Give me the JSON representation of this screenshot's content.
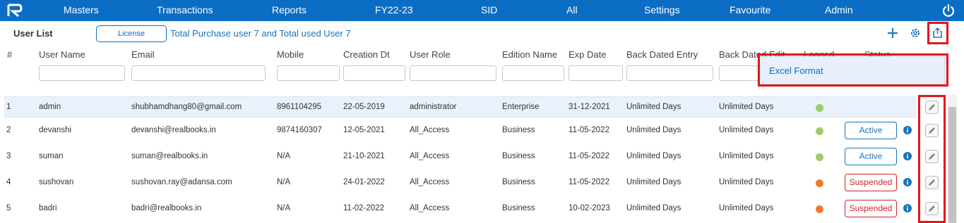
{
  "nav": {
    "items": [
      "Masters",
      "Transactions",
      "Reports",
      "FY22-23",
      "SID",
      "All",
      "Settings",
      "Favourite",
      "Admin"
    ],
    "logo_icon": "realbooks-logo-icon",
    "power_icon": "power-icon"
  },
  "toolbar": {
    "title": "User List",
    "license_label": "License",
    "license_info": "Total Purchase user 7 and Total used User 7",
    "add_icon": "plus-icon",
    "settings_icon": "gear-icon",
    "export_icon": "export-share-icon"
  },
  "export_menu": {
    "items": [
      "Excel Format"
    ]
  },
  "table": {
    "columns": [
      "#",
      "User Name",
      "Email",
      "Mobile",
      "Creation Dt",
      "User Role",
      "Edition Name",
      "Exp Date",
      "Back Dated Entry",
      "Back Dated Edit",
      "Logged",
      "Status"
    ],
    "rows": [
      {
        "num": "1",
        "user": "admin",
        "email": "shubhamdhang80@gmail.com",
        "mobile": "8961104295",
        "created": "22-05-2019",
        "role": "administrator",
        "edition": "Enterprise",
        "exp": "31-12-2021",
        "bde": "Unlimited Days",
        "bded": "Unlimited Days",
        "logged": "green",
        "status": ""
      },
      {
        "num": "2",
        "user": "devanshi",
        "email": "devanshi@realbooks.in",
        "mobile": "9874160307",
        "created": "12-05-2021",
        "role": "All_Access",
        "edition": "Business",
        "exp": "11-05-2022",
        "bde": "Unlimited Days",
        "bded": "Unlimited Days",
        "logged": "green",
        "status": "Active"
      },
      {
        "num": "3",
        "user": "suman",
        "email": "suman@realbooks.in",
        "mobile": "N/A",
        "created": "21-10-2021",
        "role": "All_Access",
        "edition": "Business",
        "exp": "11-05-2022",
        "bde": "Unlimited Days",
        "bded": "Unlimited Days",
        "logged": "green",
        "status": "Active"
      },
      {
        "num": "4",
        "user": "sushovan",
        "email": "sushovan.ray@adansa.com",
        "mobile": "N/A",
        "created": "24-01-2022",
        "role": "All_Access",
        "edition": "Business",
        "exp": "11-05-2022",
        "bde": "Unlimited Days",
        "bded": "Unlimited Days",
        "logged": "orange",
        "status": "Suspended"
      },
      {
        "num": "5",
        "user": "badri",
        "email": "badri@realbooks.in",
        "mobile": "N/A",
        "created": "11-02-2022",
        "role": "All_Access",
        "edition": "Business",
        "exp": "10-02-2023",
        "bde": "Unlimited Days",
        "bded": "Unlimited Days",
        "logged": "orange",
        "status": "Suspended"
      }
    ]
  },
  "colors": {
    "nav_bg": "#0b6dc4",
    "logged_green": "#9ccc65",
    "logged_orange": "#f07a2b",
    "highlight": "#e0151d",
    "active": "#1a73b9",
    "suspended": "#d0232b"
  }
}
